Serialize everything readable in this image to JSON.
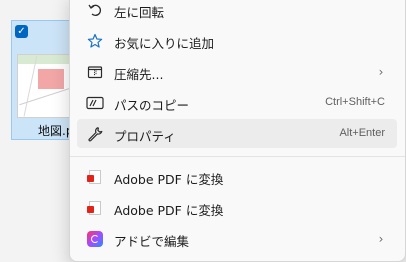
{
  "file_tile": {
    "name": "地図.p",
    "checked": true
  },
  "menu": {
    "items": [
      {
        "label": "左に回転",
        "icon": "rotate-left-icon"
      },
      {
        "label": "お気に入りに追加",
        "icon": "star-icon"
      },
      {
        "label": "圧縮先...",
        "icon": "zip-folder-icon",
        "submenu": true
      },
      {
        "label": "パスのコピー",
        "icon": "copy-path-icon",
        "shortcut": "Ctrl+Shift+C"
      },
      {
        "label": "プロパティ",
        "icon": "wrench-icon",
        "shortcut": "Alt+Enter",
        "highlighted": true
      },
      {
        "label": "Adobe PDF に変換",
        "icon": "adobe-pdf-icon"
      },
      {
        "label": "Adobe PDF に変換",
        "icon": "adobe-pdf-icon"
      },
      {
        "label": "アドビで編集",
        "icon": "creative-cloud-icon",
        "submenu": true
      }
    ],
    "chevron": "›"
  }
}
